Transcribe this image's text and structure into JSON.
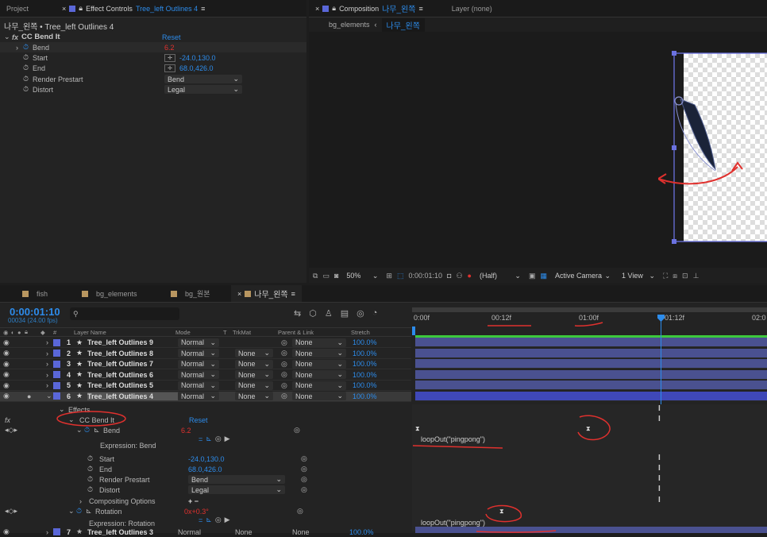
{
  "effect_panel": {
    "tab_project": "Project",
    "tab_effect_prefix": "Effect Controls",
    "tab_effect_layer": "Tree_left Outlines 4",
    "breadcrumb": "나무_왼쪽 • Tree_left Outlines 4",
    "effect_name": "CC Bend It",
    "reset": "Reset",
    "props": [
      {
        "name": "Bend",
        "value": "6.2"
      },
      {
        "name": "Start",
        "value": "-24.0,130.0"
      },
      {
        "name": "End",
        "value": "68.0,426.0"
      },
      {
        "name": "Render Prestart",
        "value": "Bend"
      },
      {
        "name": "Distort",
        "value": "Legal"
      }
    ]
  },
  "comp_panel": {
    "tab_prefix": "Composition",
    "comp_name": "나무_왼쪽",
    "layer_tab": "Layer (none)",
    "crumb_1": "bg_elements",
    "crumb_2": "나무_왼쪽",
    "zoom": "50%",
    "timecode": "0:00:01:10",
    "resolution": "(Half)",
    "camera": "Active Camera",
    "view": "1 View"
  },
  "timeline": {
    "tabs": [
      "fish",
      "bg_elements",
      "bg_원본",
      "나무_왼쪽"
    ],
    "tab_colors": [
      "#c8a060",
      "#c8a060",
      "#c8a060",
      "#c8a060"
    ],
    "timecode": "0:00:01:10",
    "frame": "00034 (24.00 fps)",
    "search_placeholder": "",
    "headers": {
      "num": "#",
      "layer_name": "Layer Name",
      "mode": "Mode",
      "t": "T",
      "trkmat": "TrkMat",
      "parent": "Parent & Link",
      "stretch": "Stretch"
    },
    "ruler": [
      "0:00f",
      "00:12f",
      "01:00f",
      "01:12f",
      "02:0"
    ],
    "layers": [
      {
        "num": "1",
        "name": "Tree_left Outlines 9",
        "mode": "Normal",
        "trkmat": "",
        "parent": "None",
        "stretch": "100.0%"
      },
      {
        "num": "2",
        "name": "Tree_left Outlines 8",
        "mode": "Normal",
        "trkmat": "None",
        "parent": "None",
        "stretch": "100.0%"
      },
      {
        "num": "3",
        "name": "Tree_left Outlines 7",
        "mode": "Normal",
        "trkmat": "None",
        "parent": "None",
        "stretch": "100.0%"
      },
      {
        "num": "4",
        "name": "Tree_left Outlines 6",
        "mode": "Normal",
        "trkmat": "None",
        "parent": "None",
        "stretch": "100.0%"
      },
      {
        "num": "5",
        "name": "Tree_left Outlines 5",
        "mode": "Normal",
        "trkmat": "None",
        "parent": "None",
        "stretch": "100.0%"
      },
      {
        "num": "6",
        "name": "Tree_left Outlines 4",
        "mode": "Normal",
        "trkmat": "None",
        "parent": "None",
        "stretch": "100.0%"
      }
    ],
    "effects_label": "Effects",
    "effect_name": "CC Bend It",
    "reset": "Reset",
    "bend_label": "Bend",
    "bend_value": "6.2",
    "expr_bend_label": "Expression: Bend",
    "expr_bend_code": "loopOut(\"pingpong\")",
    "start_label": "Start",
    "start_value": "-24.0,130.0",
    "end_label": "End",
    "end_value": "68.0,426.0",
    "render_label": "Render Prestart",
    "render_value": "Bend",
    "distort_label": "Distort",
    "distort_value": "Legal",
    "compositing_label": "Compositing Options",
    "compositing_value": "+ −",
    "rotation_label": "Rotation",
    "rotation_value": "0x+0.3°",
    "expr_rot_label": "Expression: Rotation",
    "expr_rot_code": "loopOut(\"pingpong\")",
    "row7_num": "7",
    "row7_name": "Tree_left Outlines 3",
    "row7_mode": "Normal",
    "row7_trkmat": "None",
    "row7_parent": "None",
    "row7_stretch": "100.0%"
  }
}
